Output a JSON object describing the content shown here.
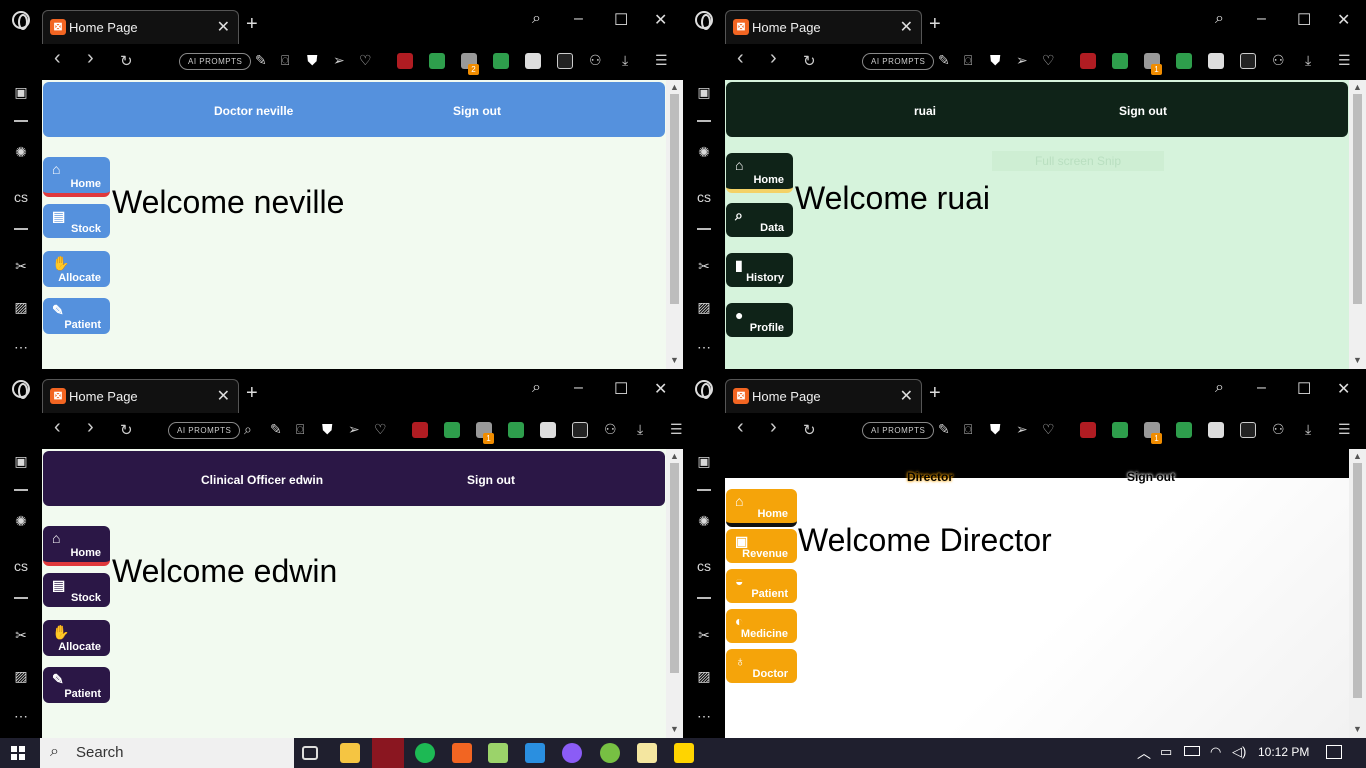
{
  "common": {
    "tab_title": "Home Page",
    "ai_prompts": "AI PROMPTS",
    "sign_out": "Sign out"
  },
  "q1": {
    "user_label": "Doctor neville",
    "welcome": "Welcome neville",
    "badge": "2",
    "nav": [
      {
        "label": "Home",
        "icon": "home-icon"
      },
      {
        "label": "Stock",
        "icon": "warehouse-icon"
      },
      {
        "label": "Allocate",
        "icon": "handshake-icon"
      },
      {
        "label": "Patient",
        "icon": "pencil-icon"
      }
    ],
    "colors": {
      "bar": "#5591dd",
      "bg": "#f2faf0",
      "active": "#e0393c"
    }
  },
  "q2": {
    "user_label": "ruai",
    "welcome": "Welcome ruai",
    "badge": "1",
    "faded_text": "Full screen Snip",
    "nav": [
      {
        "label": "Home",
        "icon": "home-icon"
      },
      {
        "label": "Data",
        "icon": "search-icon"
      },
      {
        "label": "History",
        "icon": "book-icon"
      },
      {
        "label": "Profile",
        "icon": "user-icon"
      }
    ],
    "colors": {
      "bar": "#0f2318",
      "bg": "#d6f3dc",
      "active": "#f4d267"
    }
  },
  "q3": {
    "user_label": "Clinical Officer edwin",
    "welcome": "Welcome edwin",
    "badge": "1",
    "nav": [
      {
        "label": "Home",
        "icon": "home-icon"
      },
      {
        "label": "Stock",
        "icon": "warehouse-icon"
      },
      {
        "label": "Allocate",
        "icon": "handshake-icon"
      },
      {
        "label": "Patient",
        "icon": "pencil-icon"
      }
    ],
    "colors": {
      "bar": "#2b1746",
      "bg": "#f2faf0",
      "active": "#e0393c"
    }
  },
  "q4": {
    "user_label": "Director",
    "welcome": "Welcome Director",
    "badge": "1",
    "nav": [
      {
        "label": "Home",
        "icon": "home-icon"
      },
      {
        "label": "Revenue",
        "icon": "money-icon"
      },
      {
        "label": "Patient",
        "icon": "mask-icon"
      },
      {
        "label": "Medicine",
        "icon": "pills-icon"
      },
      {
        "label": "Doctor",
        "icon": "stethoscope-icon"
      }
    ],
    "colors": {
      "bar": "#000000",
      "bg": "#ffffff",
      "button": "#f5a40a"
    }
  },
  "taskbar": {
    "search_placeholder": "Search",
    "time": "10:12 PM"
  }
}
